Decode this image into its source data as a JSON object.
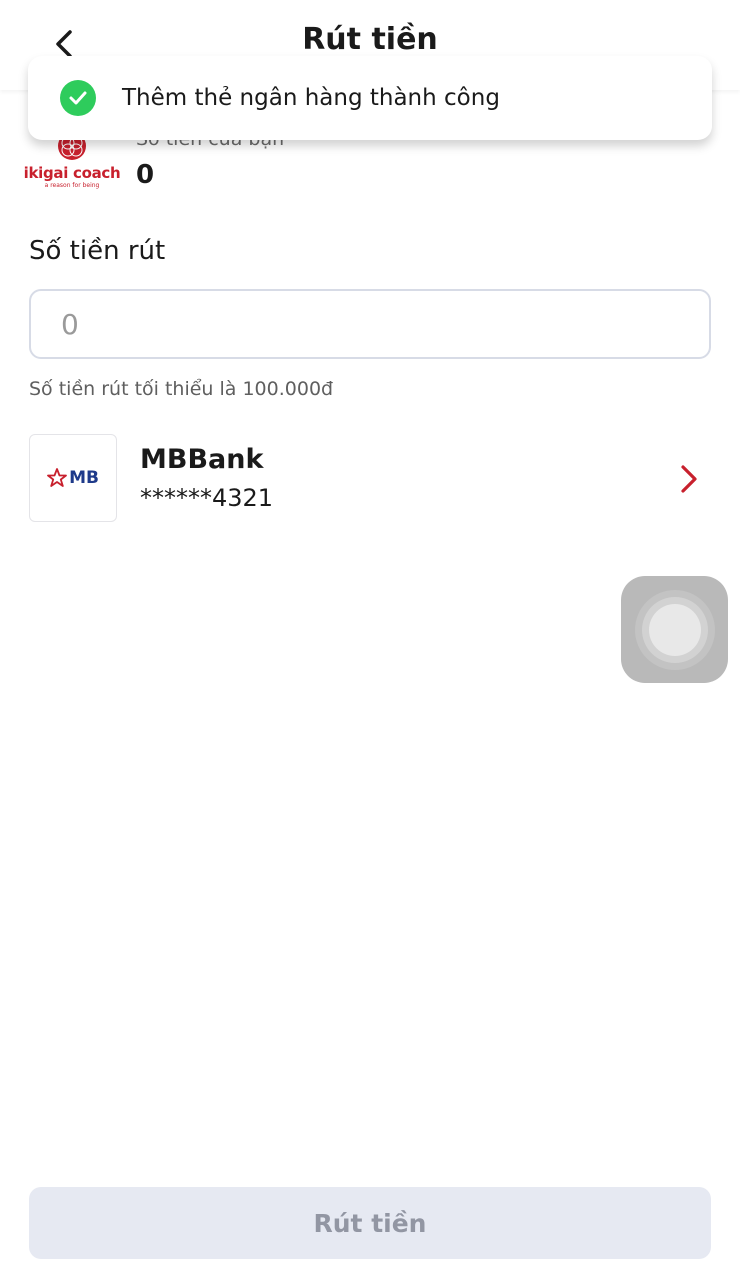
{
  "header": {
    "title": "Rút tiền",
    "back_icon": "chevron-left-icon"
  },
  "balance": {
    "brand": "ikigai coach",
    "tagline": "a reason for being",
    "label": "Số tiền của bạn",
    "value": "0"
  },
  "toast": {
    "message": "Thêm thẻ ngân hàng thành công",
    "icon": "check-circle-icon",
    "color": "#2ecc5c"
  },
  "withdraw": {
    "label": "Số tiền rút",
    "placeholder": "0",
    "value": "",
    "hint": "Số tiền rút tối thiểu là 100.000đ"
  },
  "bank": {
    "logo_text": "MB",
    "name": "MBBank",
    "account": "******4321",
    "chevron_color": "#c8202d"
  },
  "submit": {
    "label": "Rút tiền"
  }
}
